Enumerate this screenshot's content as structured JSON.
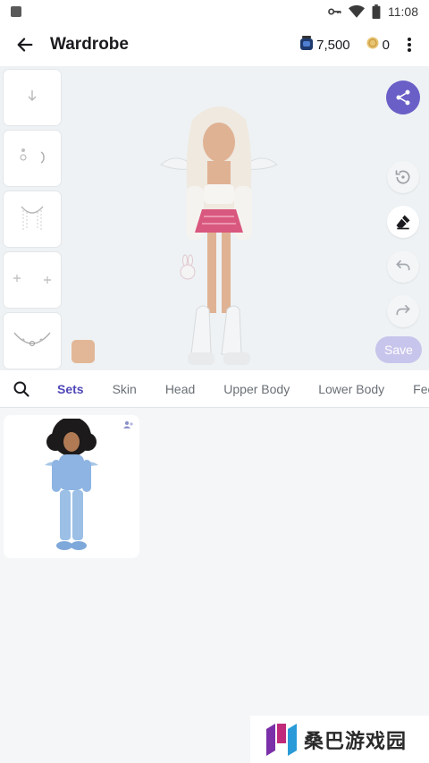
{
  "status_bar": {
    "time": "11:08"
  },
  "app_bar": {
    "title": "Wardrobe",
    "gems": "7,500",
    "coins": "0"
  },
  "tabs": [
    "Sets",
    "Skin",
    "Head",
    "Upper Body",
    "Lower Body",
    "Fee"
  ],
  "preview": {
    "save_label": "Save",
    "skin_tone": "#e2b797"
  },
  "watermark": {
    "text": "桑巴游戏园"
  },
  "colors": {
    "accent": "#6a5fc7",
    "active_tab": "#4f47b8",
    "save_disabled": "#c8c5ec"
  }
}
